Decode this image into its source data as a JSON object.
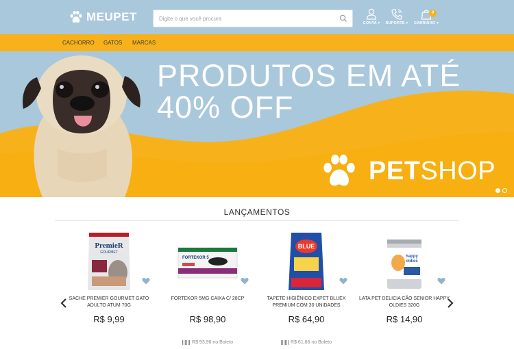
{
  "header": {
    "logo_text": "MEUPET",
    "search_placeholder": "Digite o que você procura",
    "account_label": "CONTA",
    "support_label": "SUPORTE",
    "cart_label": "CARRINHO",
    "cart_count": "0"
  },
  "nav": {
    "items": [
      "CACHORRO",
      "GATOS",
      "MARCAS"
    ]
  },
  "banner": {
    "line1": "PRODUTOS EM ATÉ",
    "line2": "40% OFF",
    "brand_bold": "PET",
    "brand_rest": "SHOP",
    "slide_count": 2,
    "active_slide": 1
  },
  "section": {
    "title": "LANÇAMENTOS"
  },
  "products": [
    {
      "name": "SACHE PREMIER GOURMET GATO ADULTO ATUM 70G",
      "price": "R$ 9,99",
      "boleto": ""
    },
    {
      "name": "FORTEKOR 5MG CAIXA C/ 28CP",
      "price": "R$ 98,90",
      "boleto": "R$ 93,96 no Boleto"
    },
    {
      "name": "TAPETE HIGIÊNICO EXPET BLUEX PREMIUM COM 30 UNIDADES",
      "price": "R$ 64,90",
      "boleto": "R$ 61,66 no Boleto"
    },
    {
      "name": "LATA PET DELICIA CÃO SENIOR HAPPY OLDIES 320G",
      "price": "R$ 14,90",
      "boleto": ""
    }
  ],
  "colors": {
    "header_bg": "#a9c8dc",
    "accent": "#f7b21b"
  }
}
